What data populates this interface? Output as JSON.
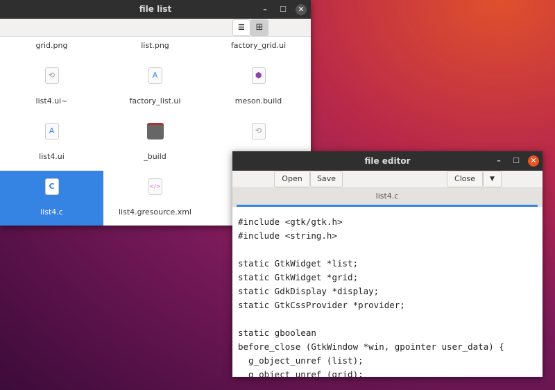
{
  "file_list": {
    "title": "file list",
    "view_buttons": {
      "list": "list-view-icon",
      "grid": "grid-view-icon"
    },
    "items": [
      {
        "label": "grid.png",
        "icon": "image-icon"
      },
      {
        "label": "list.png",
        "icon": "image-icon"
      },
      {
        "label": "factory_grid.ui",
        "icon": "ui-file-icon"
      },
      {
        "label": "list4.ui~",
        "icon": "backup-file-icon"
      },
      {
        "label": "factory_list.ui",
        "icon": "text-document-icon"
      },
      {
        "label": "meson.build",
        "icon": "meson-icon"
      },
      {
        "label": "list4.ui",
        "icon": "text-document-icon"
      },
      {
        "label": "_build",
        "icon": "folder-icon"
      },
      {
        "label": "",
        "icon": "backup-file-icon"
      },
      {
        "label": "list4.c",
        "icon": "c-source-icon",
        "selected": true
      },
      {
        "label": "list4.gresource.xml",
        "icon": "xml-file-icon"
      }
    ]
  },
  "editor": {
    "title": "file editor",
    "open": "Open",
    "save": "Save",
    "close": "Close",
    "tab": "list4.c",
    "lines": [
      "#include <gtk/gtk.h>",
      "#include <string.h>",
      "",
      "static GtkWidget *list;",
      "static GtkWidget *grid;",
      "static GdkDisplay *display;",
      "static GtkCssProvider *provider;",
      "",
      "static gboolean",
      "before_close (GtkWindow *win, gpointer user_data) {",
      "  g_object_unref (list);",
      "  g_object_unref (grid);"
    ]
  },
  "colors": {
    "selection": "#3584e4",
    "close_button": "#e95420",
    "titlebar": "#2f2f2f"
  }
}
